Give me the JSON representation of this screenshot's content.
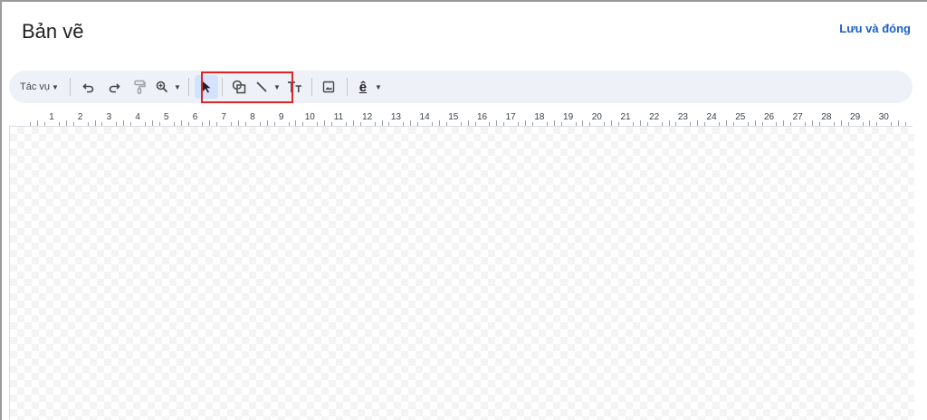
{
  "header": {
    "title": "Bản vẽ",
    "save_close_label": "Lưu và đóng"
  },
  "toolbar": {
    "actions_label": "Tác vụ",
    "actions_caret": "▼",
    "zoom_caret": "▼",
    "line_caret": "▼",
    "wordart_caret": "▼",
    "wordart_glyph": "ê",
    "icons": [
      "undo-icon",
      "redo-icon",
      "paint-format-icon",
      "zoom-icon",
      "select-icon",
      "shape-icon",
      "line-icon",
      "text-box-icon",
      "image-icon",
      "word-art-icon"
    ],
    "highlight_color": "#e02424"
  },
  "ruler": {
    "labels": [
      "1",
      "2",
      "3",
      "4",
      "5",
      "6",
      "7",
      "8",
      "9",
      "10",
      "11",
      "12",
      "13",
      "14",
      "15",
      "16",
      "17",
      "18",
      "19",
      "20",
      "21",
      "22",
      "23",
      "24",
      "25",
      "26",
      "27",
      "28",
      "29",
      "30"
    ]
  },
  "colors": {
    "accent": "#1a5fc8",
    "toolbar_bg": "#eef2f8",
    "select_active_bg": "#d3e3fd"
  }
}
